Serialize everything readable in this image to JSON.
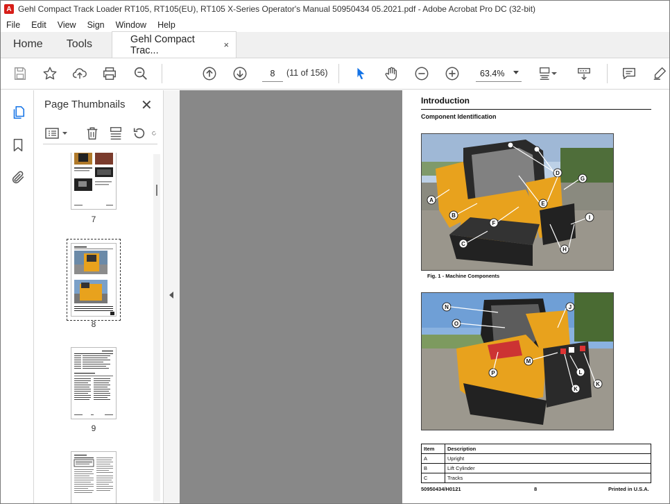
{
  "window": {
    "title": "Gehl Compact Track Loader RT105, RT105(EU), RT105 X-Series Operator's Manual 50950434 05.2021.pdf - Adobe Acrobat Pro DC (32-bit)"
  },
  "menu": [
    "File",
    "Edit",
    "View",
    "Sign",
    "Window",
    "Help"
  ],
  "tabs": {
    "home": "Home",
    "tools": "Tools",
    "document": "Gehl Compact Trac...",
    "document_close": "×"
  },
  "toolbar": {
    "page_number": "8",
    "page_count": "(11 of 156)",
    "zoom": "63.4%"
  },
  "thumbnails": {
    "title": "Page Thumbnails",
    "close": "✕",
    "items": [
      {
        "label": "7"
      },
      {
        "label": "8"
      },
      {
        "label": "9"
      },
      {
        "label": ""
      }
    ],
    "selected_label": "8"
  },
  "page": {
    "heading": "Introduction",
    "subheading": "Component Identification",
    "figure1_caption": "Fig. 1 -  Machine Components",
    "figure1_labels": [
      "A",
      "B",
      "C",
      "D",
      "E",
      "F",
      "G",
      "H",
      "I"
    ],
    "figure2_labels": [
      "N",
      "O",
      "J",
      "M",
      "L",
      "K",
      "P"
    ],
    "table": {
      "headers": [
        "Item",
        "Description"
      ],
      "rows": [
        [
          "A",
          "Upright"
        ],
        [
          "B",
          "Lift Cylinder"
        ],
        [
          "C",
          "Tracks"
        ]
      ]
    },
    "footer": {
      "left": "50950434/H0121",
      "center": "8",
      "right": "Printed in U.S.A."
    }
  },
  "colors": {
    "accent": "#1473e6",
    "doc_background": "#888888",
    "machine_yellow": "#e8a21d",
    "acrobat_red": "#d71e18"
  }
}
